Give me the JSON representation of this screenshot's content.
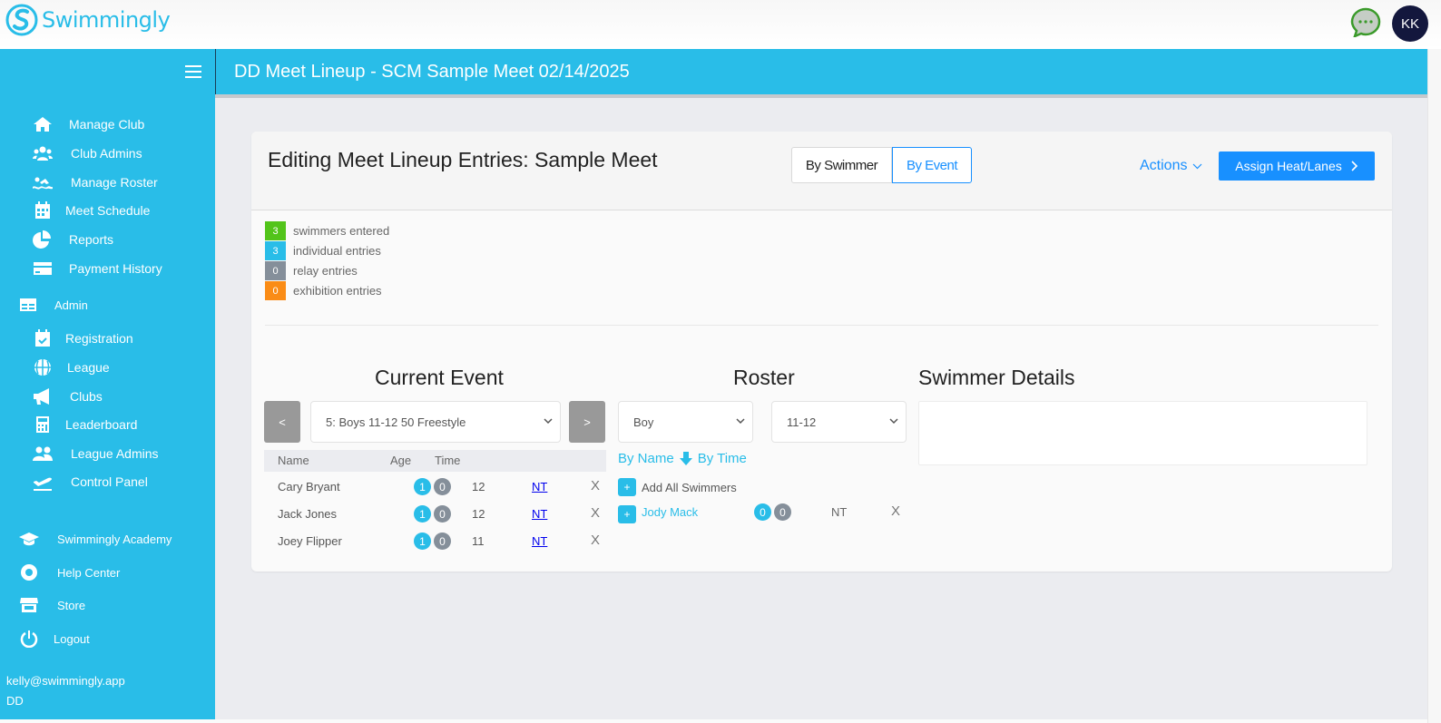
{
  "app": {
    "brand": "Swimmingly",
    "avatar_initials": "KK",
    "chat_icon": "chat-bubble-icon"
  },
  "colors": {
    "brand": "#29bde8",
    "primary": "#1890ff",
    "green": "#52c41a",
    "orange": "#fa8c16",
    "gray": "#858f9a"
  },
  "sidebar": {
    "menu_icon": "hamburger-icon",
    "items": [
      {
        "label": "Manage Club",
        "icon": "home-icon"
      },
      {
        "label": "Club Admins",
        "icon": "users-icon"
      },
      {
        "label": "Manage Roster",
        "icon": "swimmer-icon"
      },
      {
        "label": "Meet Schedule",
        "icon": "calendar-icon"
      },
      {
        "label": "Reports",
        "icon": "pie-chart-icon"
      },
      {
        "label": "Payment History",
        "icon": "credit-card-icon"
      }
    ],
    "admin": {
      "label": "Admin",
      "icon": "table-icon"
    },
    "admin_items": [
      {
        "label": "Registration",
        "icon": "calendar-check-icon"
      },
      {
        "label": "League",
        "icon": "globe-icon"
      },
      {
        "label": "Clubs",
        "icon": "megaphone-icon"
      },
      {
        "label": "Leaderboard",
        "icon": "calculator-icon"
      },
      {
        "label": "League Admins",
        "icon": "user-friends-icon"
      },
      {
        "label": "Control Panel",
        "icon": "plane-departure-icon"
      }
    ],
    "footer_items": [
      {
        "label": "Swimmingly Academy",
        "icon": "graduation-cap-icon"
      },
      {
        "label": "Help Center",
        "icon": "life-ring-icon"
      },
      {
        "label": "Store",
        "icon": "store-icon"
      },
      {
        "label": "Logout",
        "icon": "power-icon"
      }
    ],
    "user_email": "kelly@swimmingly.app",
    "club_code": "DD"
  },
  "header": {
    "title": "DD Meet Lineup - SCM Sample Meet 02/14/2025"
  },
  "card": {
    "title": "Editing Meet Lineup Entries: Sample Meet",
    "view_toggle": {
      "options": [
        "By Swimmer",
        "By Event"
      ],
      "selected": "By Event"
    },
    "actions_label": "Actions",
    "assign_label": "Assign Heat/Lanes"
  },
  "stats": [
    {
      "count": "3",
      "label": "swimmers entered",
      "color": "#52c41a"
    },
    {
      "count": "3",
      "label": "individual entries",
      "color": "#29bde8"
    },
    {
      "count": "0",
      "label": "relay entries",
      "color": "#858f9a"
    },
    {
      "count": "0",
      "label": "exhibition entries",
      "color": "#fa8c16"
    }
  ],
  "current_event": {
    "heading": "Current Event",
    "prev_label": "<",
    "next_label": ">",
    "selected_event": "5: Boys 11-12 50 Freestyle",
    "columns": [
      "Name",
      "Age",
      "Time"
    ],
    "entries": [
      {
        "name": "Cary Bryant",
        "badge1": "1",
        "badge2": "0",
        "age": "12",
        "time": "NT",
        "remove": "X"
      },
      {
        "name": "Jack Jones",
        "badge1": "1",
        "badge2": "0",
        "age": "12",
        "time": "NT",
        "remove": "X"
      },
      {
        "name": "Joey Flipper",
        "badge1": "1",
        "badge2": "0",
        "age": "11",
        "time": "NT",
        "remove": "X"
      }
    ]
  },
  "roster": {
    "heading": "Roster",
    "gender_filter": "Boy",
    "age_filter": "11-12",
    "sort_by_name": "By Name",
    "sort_by_time": "By Time",
    "add_all_label": "Add All Swimmers",
    "add_symbol": "+",
    "swimmers": [
      {
        "name": "Jody Mack",
        "badge1": "0",
        "badge2": "0",
        "time": "NT",
        "remove": "X"
      }
    ]
  },
  "swimmer_details": {
    "heading": "Swimmer Details"
  }
}
